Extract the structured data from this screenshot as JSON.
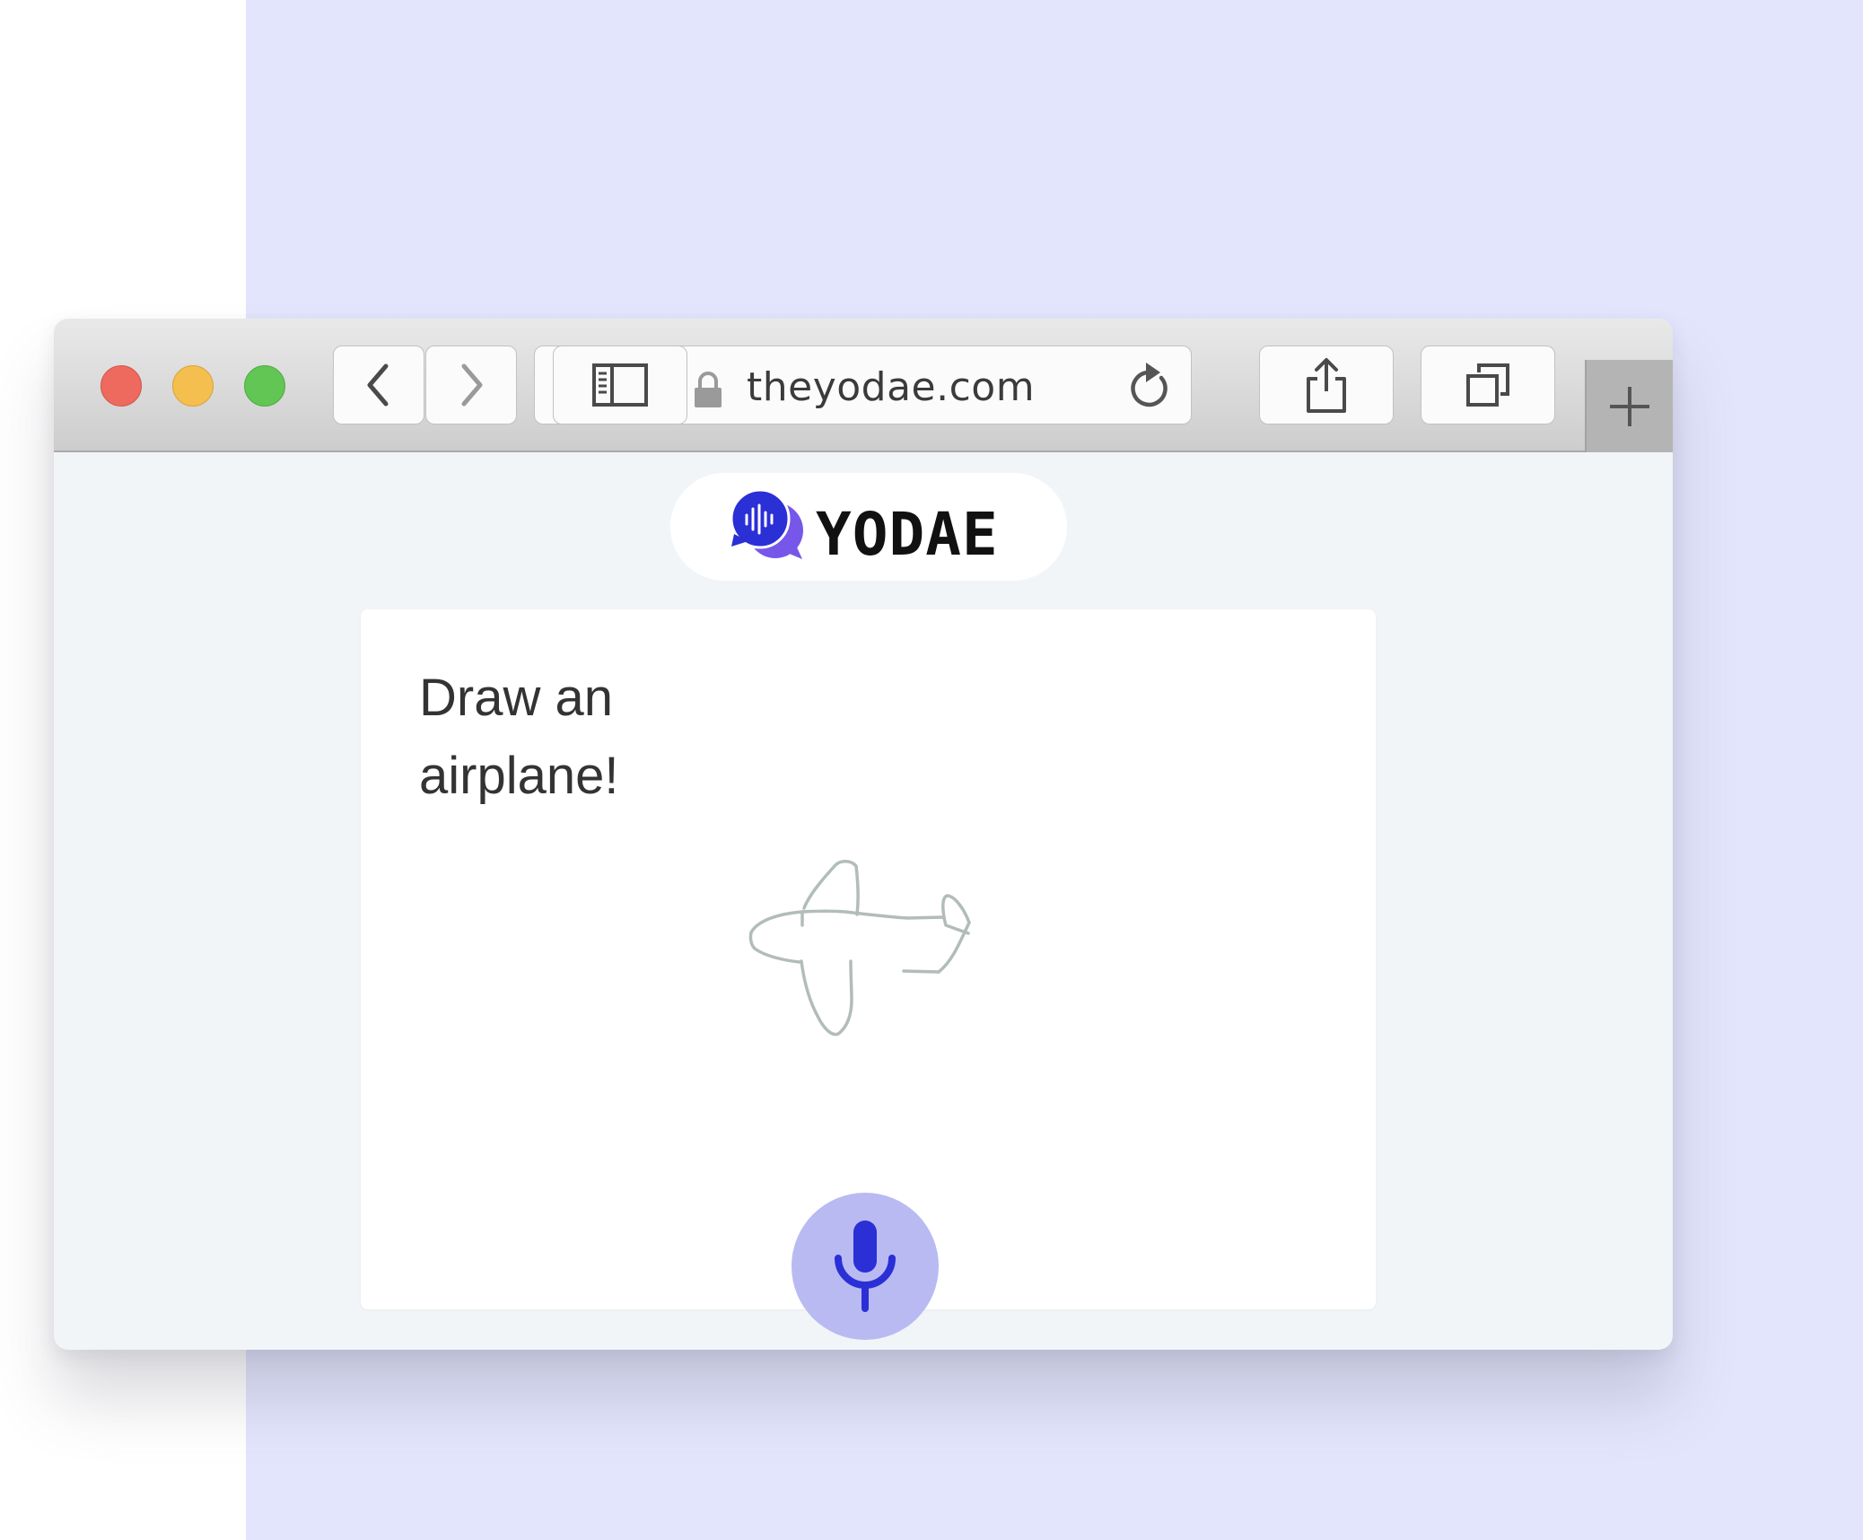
{
  "browser": {
    "url": "theyodae.com",
    "back_icon": "chevron-left-icon",
    "forward_icon": "chevron-right-icon",
    "sidebar_icon": "sidebar-icon",
    "lock_icon": "lock-icon",
    "reload_icon": "reload-icon",
    "share_icon": "share-icon",
    "tabs_icon": "tabs-overview-icon",
    "new_tab_icon": "plus-icon"
  },
  "app": {
    "brand": "YODAE",
    "logo_icon": "voice-chat-bubbles-icon",
    "prompt": "Draw an airplane!",
    "drawing": "airplane-sketch",
    "mic_icon": "microphone-icon"
  },
  "colors": {
    "background_panel": "#e3e5fd",
    "brand_primary": "#2b2fd6",
    "brand_secondary": "#7657ea",
    "mic_button": "#b9baf2",
    "sketch_stroke": "#b2bcbb",
    "close": "#ee6a5f",
    "minimize": "#f5bf4f",
    "zoom": "#62c655"
  }
}
